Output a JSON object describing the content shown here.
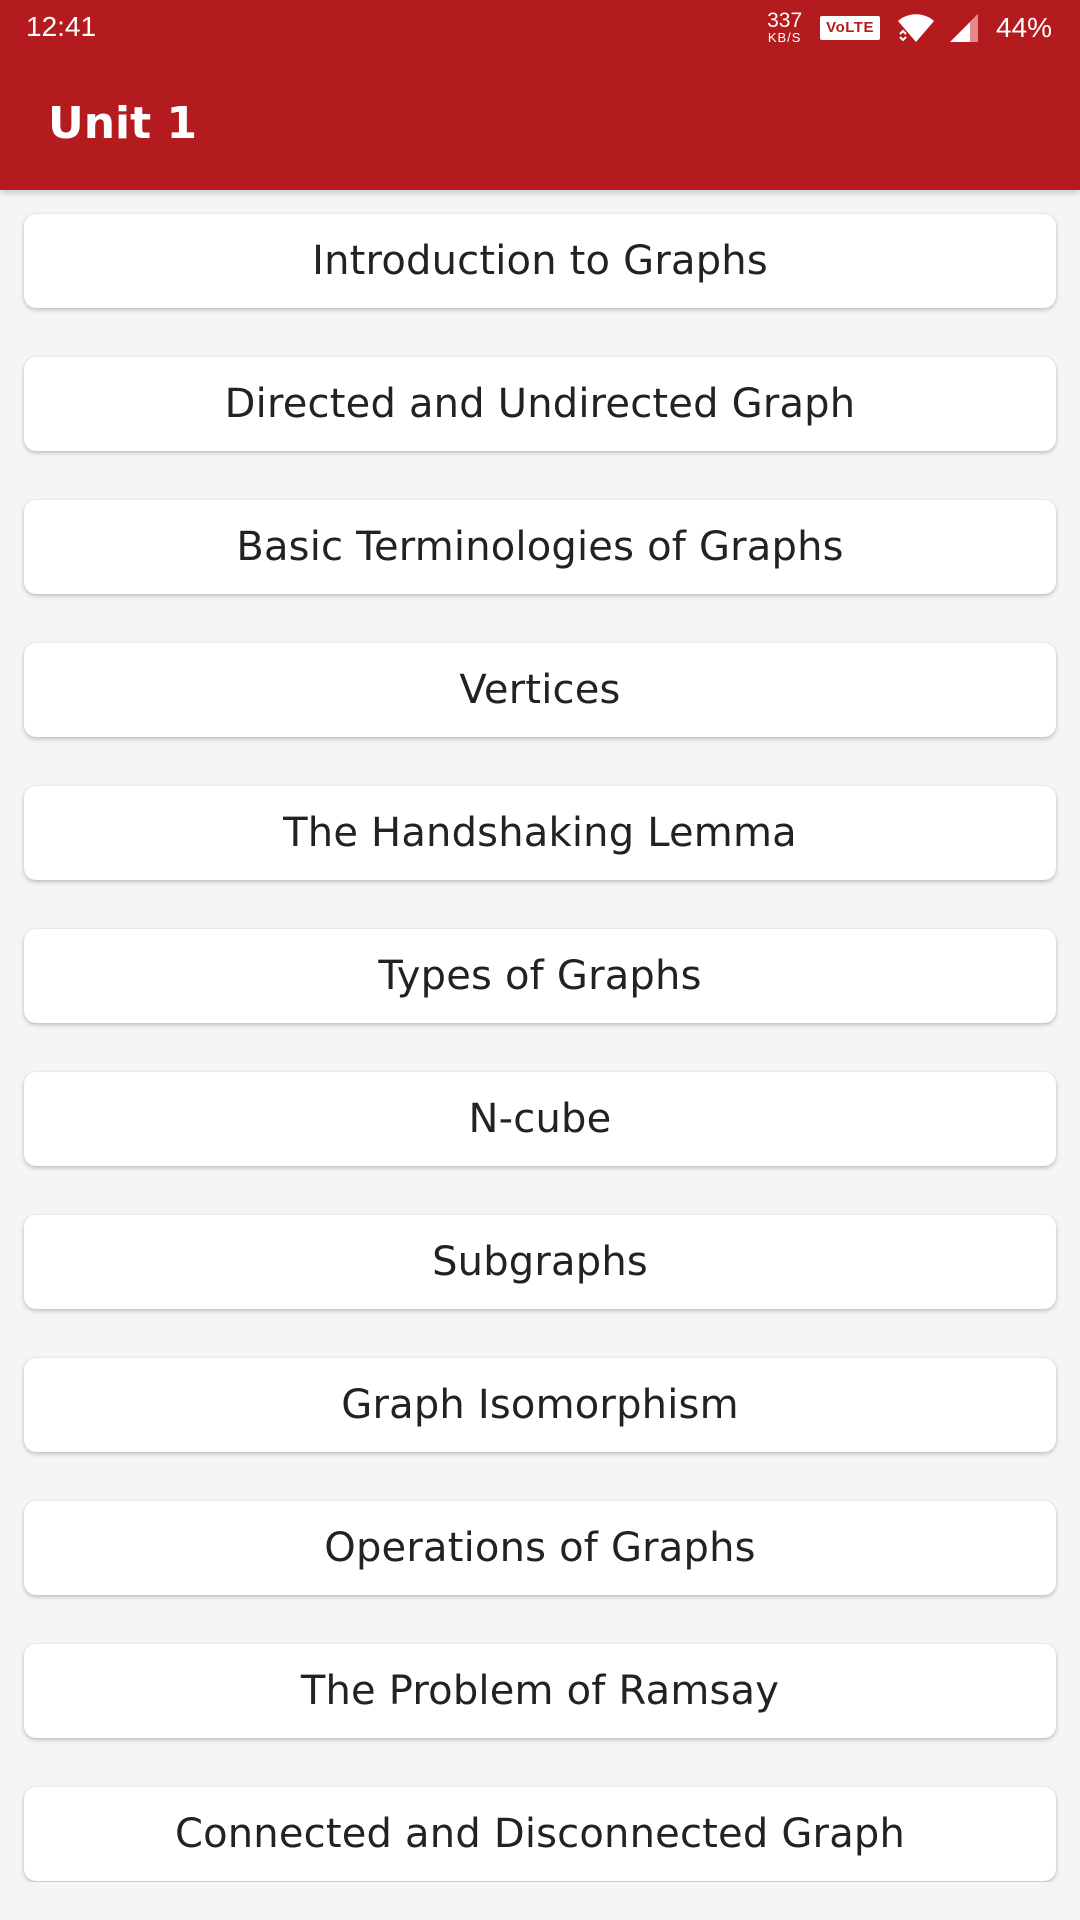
{
  "status_bar": {
    "time": "12:41",
    "net_speed_value": "337",
    "net_speed_unit": "KB/S",
    "volte": "VoLTE",
    "battery": "44%",
    "icons": [
      "wifi-icon",
      "signal-icon"
    ]
  },
  "app_bar": {
    "title": "Unit 1",
    "color": "#b41b1e"
  },
  "topics": [
    {
      "label": "Introduction to Graphs"
    },
    {
      "label": "Directed and Undirected Graph"
    },
    {
      "label": "Basic Terminologies of Graphs"
    },
    {
      "label": "Vertices"
    },
    {
      "label": "The Handshaking Lemma"
    },
    {
      "label": "Types of Graphs"
    },
    {
      "label": "N-cube"
    },
    {
      "label": "Subgraphs"
    },
    {
      "label": "Graph Isomorphism"
    },
    {
      "label": "Operations of Graphs"
    },
    {
      "label": "The Problem of Ramsay"
    },
    {
      "label": "Connected and Disconnected Graph"
    }
  ]
}
